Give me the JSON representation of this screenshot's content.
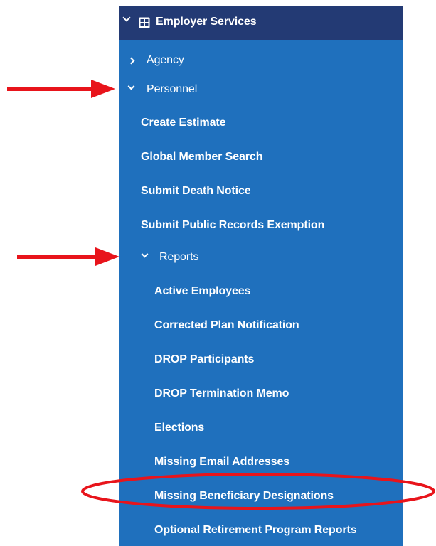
{
  "nav": {
    "header": {
      "label": "Employer Services",
      "icon": "grid-icon",
      "expanded": true
    },
    "items": [
      {
        "label": "Agency",
        "expandable": true,
        "expanded": false
      },
      {
        "label": "Personnel",
        "expandable": true,
        "expanded": true
      },
      {
        "label": "Create Estimate"
      },
      {
        "label": "Global Member Search"
      },
      {
        "label": "Submit Death Notice"
      },
      {
        "label": "Submit Public Records Exemption"
      },
      {
        "label": "Reports",
        "expandable": true,
        "expanded": true
      },
      {
        "label": "Active Employees"
      },
      {
        "label": "Corrected Plan Notification"
      },
      {
        "label": "DROP Participants"
      },
      {
        "label": "DROP Termination Memo"
      },
      {
        "label": "Elections"
      },
      {
        "label": "Missing Email Addresses"
      },
      {
        "label": "Missing Beneficiary Designations",
        "highlighted": true
      },
      {
        "label": "Optional Retirement Program Reports"
      }
    ]
  },
  "annotations": {
    "arrows": [
      "Personnel",
      "Reports"
    ],
    "circled": "Missing Beneficiary Designations"
  },
  "colors": {
    "panel": "#1f70bd",
    "header": "#233a74",
    "text": "#ffffff",
    "annotation": "#e8141b"
  }
}
